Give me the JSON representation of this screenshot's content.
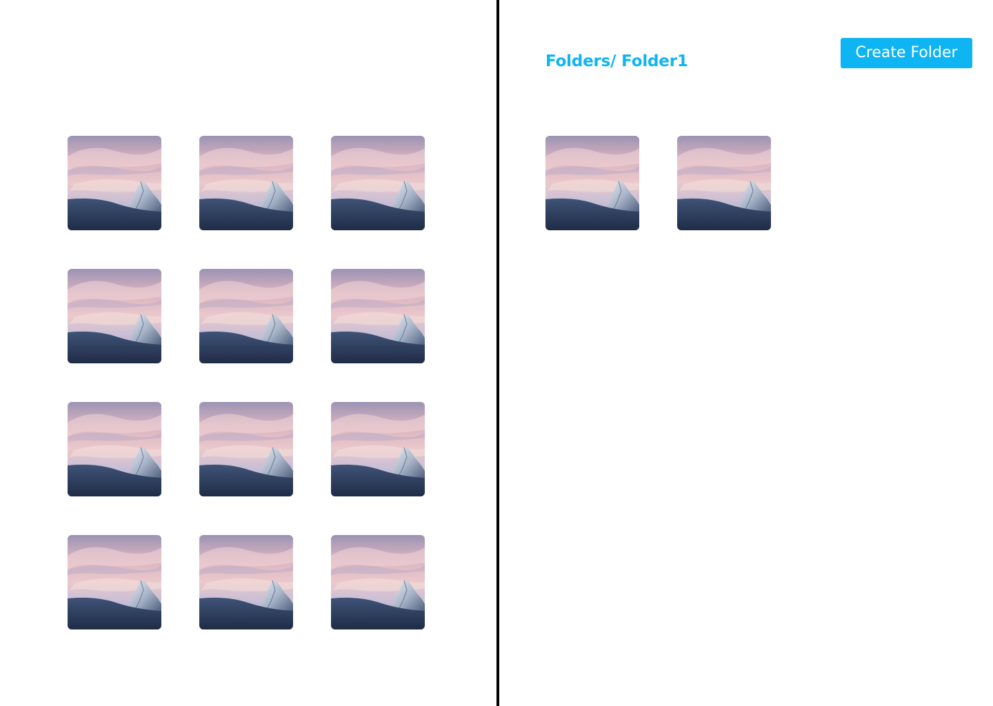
{
  "theme": {
    "accent_color": "#0fb4f2",
    "divider_color": "#000000"
  },
  "header": {
    "breadcrumb": "Folders/ Folder1",
    "create_folder_label": "Create Folder"
  },
  "library": {
    "thumbnail_icon": "mountain-photo",
    "items": [
      {
        "image": "mountain-photo"
      },
      {
        "image": "mountain-photo"
      },
      {
        "image": "mountain-photo"
      },
      {
        "image": "mountain-photo"
      },
      {
        "image": "mountain-photo"
      },
      {
        "image": "mountain-photo"
      },
      {
        "image": "mountain-photo"
      },
      {
        "image": "mountain-photo"
      },
      {
        "image": "mountain-photo"
      },
      {
        "image": "mountain-photo"
      },
      {
        "image": "mountain-photo"
      },
      {
        "image": "mountain-photo"
      }
    ]
  },
  "folder": {
    "items": [
      {
        "image": "mountain-photo"
      },
      {
        "image": "mountain-photo"
      }
    ]
  }
}
